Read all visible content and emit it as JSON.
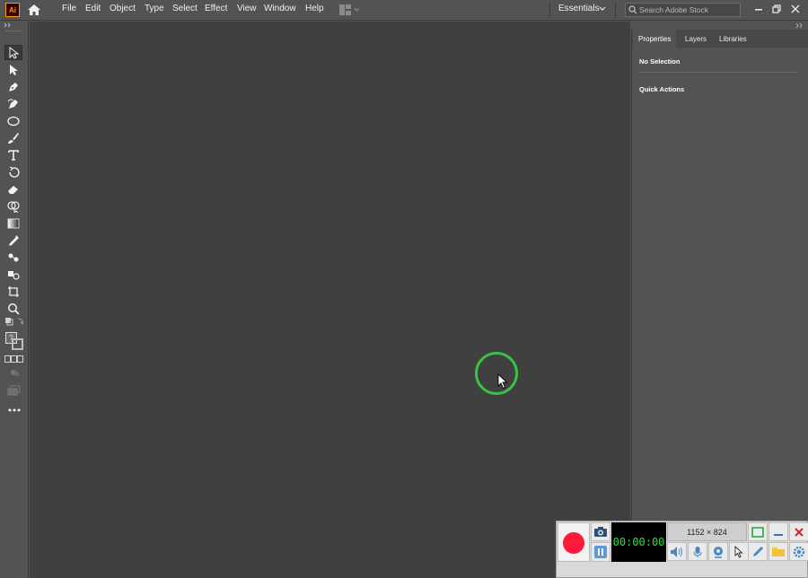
{
  "app": {
    "logo_text": "Ai"
  },
  "menu": [
    {
      "label": "File"
    },
    {
      "label": "Edit"
    },
    {
      "label": "Object"
    },
    {
      "label": "Type"
    },
    {
      "label": "Select"
    },
    {
      "label": "Effect"
    },
    {
      "label": "View"
    },
    {
      "label": "Window"
    },
    {
      "label": "Help"
    }
  ],
  "workspace": {
    "label": "Essentials"
  },
  "search": {
    "placeholder": "Search Adobe Stock"
  },
  "tools": [
    {
      "name": "selection-tool-icon"
    },
    {
      "name": "direct-selection-tool-icon"
    },
    {
      "name": "pen-tool-icon"
    },
    {
      "name": "curvature-tool-icon"
    },
    {
      "name": "ellipse-tool-icon"
    },
    {
      "name": "paintbrush-tool-icon"
    },
    {
      "name": "type-tool-icon"
    },
    {
      "name": "rotate-tool-icon"
    },
    {
      "name": "eraser-tool-icon"
    },
    {
      "name": "shape-builder-tool-icon"
    },
    {
      "name": "gradient-tool-icon"
    },
    {
      "name": "eyedropper-tool-icon"
    },
    {
      "name": "blend-tool-icon"
    },
    {
      "name": "symbol-sprayer-tool-icon"
    },
    {
      "name": "artboard-tool-icon"
    },
    {
      "name": "zoom-tool-icon"
    }
  ],
  "panel": {
    "tabs": [
      {
        "label": "Properties",
        "active": true
      },
      {
        "label": "Layers",
        "active": false
      },
      {
        "label": "Libraries",
        "active": false
      }
    ],
    "no_selection": "No Selection",
    "quick_actions": "Quick Actions"
  },
  "recorder": {
    "timer": "00:00:00",
    "resolution": "1152 × 824"
  },
  "colors": {
    "accent_orange": "#ff9a00",
    "canvas": "#404040",
    "chrome": "#535353",
    "click_ring": "#37c244",
    "record_red": "#ff1a3a",
    "timer_green": "#1ee83a"
  }
}
